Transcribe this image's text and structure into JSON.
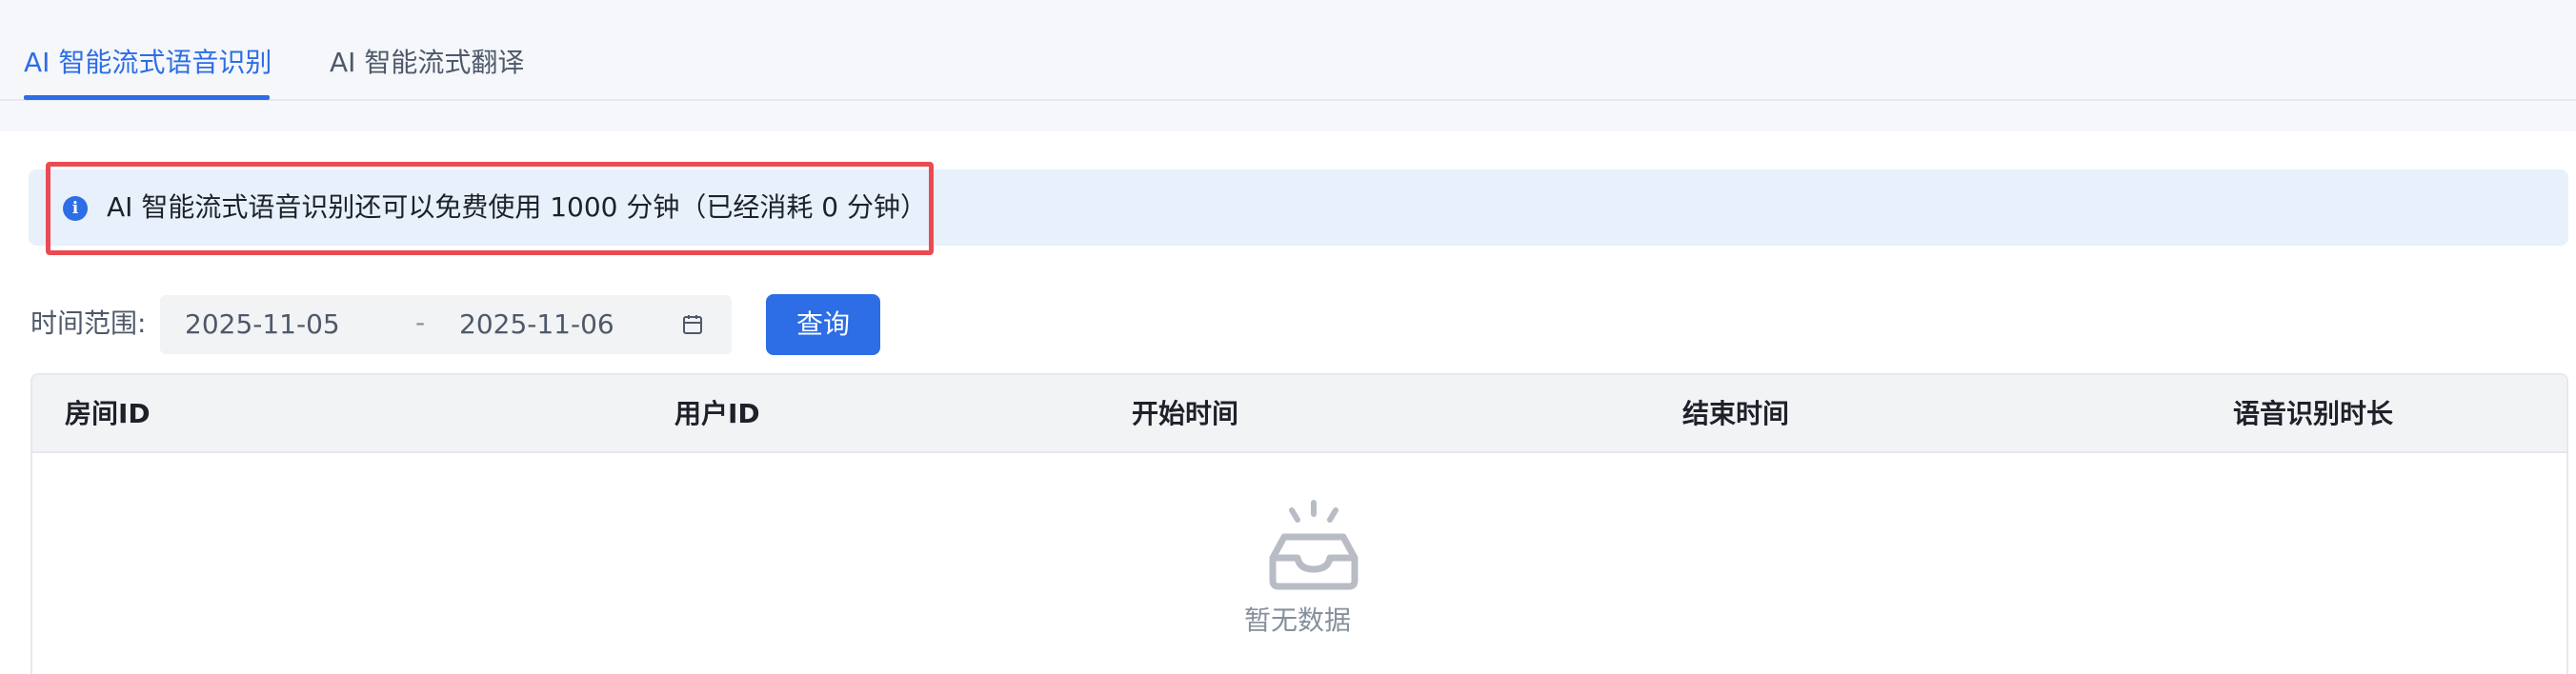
{
  "tabs": [
    {
      "label": "AI 智能流式语音识别",
      "active": true
    },
    {
      "label": "AI 智能流式翻译",
      "active": false
    }
  ],
  "alert": {
    "icon": "info-icon",
    "text": "AI 智能流式语音识别还可以免费使用 1000 分钟（已经消耗 0 分钟）"
  },
  "filter": {
    "label": "时间范围:",
    "start_date": "2025-11-05",
    "separator": "-",
    "end_date": "2025-11-06",
    "calendar_icon": "calendar-icon",
    "query_label": "查询"
  },
  "table": {
    "columns": [
      "房间ID",
      "用户ID",
      "开始时间",
      "结束时间",
      "语音识别时长"
    ],
    "rows": [],
    "empty_text": "暂无数据",
    "empty_icon": "empty-inbox-icon"
  },
  "colors": {
    "accent": "#2d6de5",
    "highlight": "#ea4b52",
    "alert_bg": "#e8f0fc"
  }
}
